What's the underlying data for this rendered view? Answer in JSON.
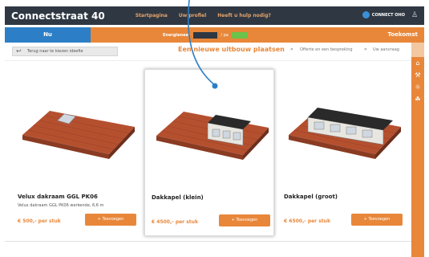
{
  "app": {
    "brand": "Connectstraat 40"
  },
  "nav": {
    "items": [
      "Startpagina",
      "Uw profiel",
      "Heeft u hulp nodig?"
    ]
  },
  "connect": {
    "label": "CONNECT OHO"
  },
  "tabs": {
    "now": "Nu",
    "future": "Toekomst"
  },
  "energy": {
    "label": "Energieneer",
    "meter": "",
    "sep": "/ pa"
  },
  "crumbs": {
    "back": "Terug naar te kiezen ideefie",
    "step1": "Een nieuwe uitbouw plaatsen",
    "sep": "»",
    "step2": "Offerte en een bespreking",
    "step3": "Uw aanvraag"
  },
  "products": [
    {
      "title": "Velux dakraam GGL PK06",
      "desc": "Velux dakraam GGL PK06 werkende, 6,6 m",
      "price": "€ 500,- per stuk",
      "button": "+ Toevoegen"
    },
    {
      "title": "Dakkapel (klein)",
      "desc": "",
      "price": "€ 4500,- per stuk",
      "button": "+ Toevoegen"
    },
    {
      "title": "Dakkapel (groot)",
      "desc": "",
      "price": "€ 6500,- per stuk",
      "button": "+ Toevoegen"
    }
  ],
  "colors": {
    "orange": "#e8873a",
    "blue": "#2c7fc6",
    "dark": "#2f3842"
  },
  "icons": {
    "sidebar": [
      "house-icon",
      "tool-icon",
      "lightbulb-icon",
      "leaf-icon"
    ],
    "user": "user-icon"
  }
}
